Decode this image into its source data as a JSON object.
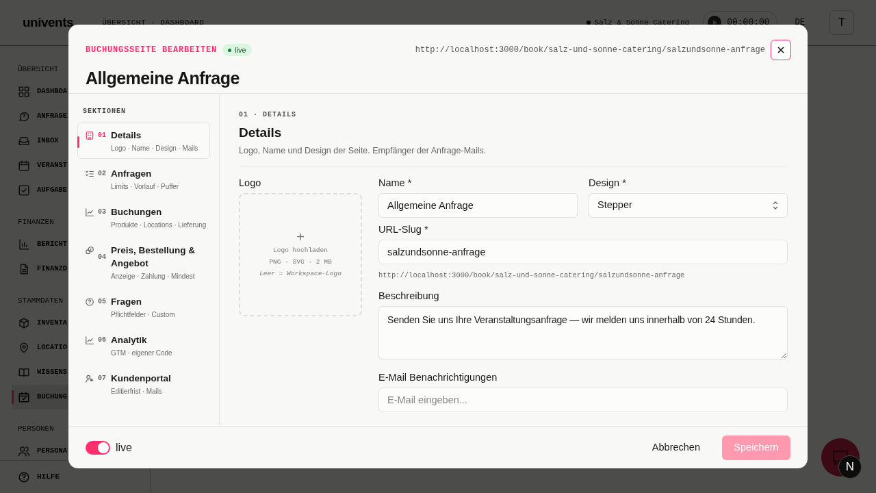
{
  "app": {
    "logo": "univents",
    "breadcrumb": "ÜBERSICHT · DASHBOARD",
    "workspace": "Salz & Sonne Catering",
    "timer": "00:00:00",
    "language": "DE",
    "avatar": "T"
  },
  "sidebar": {
    "groups": [
      {
        "title": "ÜBERSICHT",
        "items": [
          {
            "label": "DASHBOA",
            "selected": false
          },
          {
            "label": "ANFRAGE",
            "selected": false
          },
          {
            "label": "INBOX",
            "selected": false
          },
          {
            "label": "VERANST",
            "selected": false
          },
          {
            "label": "AUFGABE",
            "selected": false
          }
        ]
      },
      {
        "title": "FINANZEN",
        "items": [
          {
            "label": "BERICHT",
            "selected": false
          },
          {
            "label": "FINANZD",
            "selected": false
          }
        ]
      },
      {
        "title": "STAMMDATEN",
        "items": [
          {
            "label": "INVENTA",
            "selected": false
          },
          {
            "label": "LOCATIO",
            "selected": false
          },
          {
            "label": "WISSENS",
            "selected": false
          },
          {
            "label": "BUCHUNG",
            "selected": true
          }
        ]
      },
      {
        "title": "PERSONEN",
        "items": [
          {
            "label": "PERSONA",
            "selected": false
          }
        ]
      }
    ],
    "help": "HILFE"
  },
  "modal": {
    "eyebrow": "BUCHUNGSSEITE BEARBEITEN",
    "status": "live",
    "url": "http://localhost:3000/book/salz-und-sonne-catering/salzundsonne-anfrage",
    "title": "Allgemeine Anfrage",
    "sections_title": "SEKTIONEN",
    "sections": [
      {
        "number": "01",
        "title": "Details",
        "subtitle": "Logo · Name · Design · Mails",
        "selected": true
      },
      {
        "number": "02",
        "title": "Anfragen",
        "subtitle": "Limits · Vorlauf · Puffer",
        "selected": false
      },
      {
        "number": "03",
        "title": "Buchungen",
        "subtitle": "Produkte · Locations · Lieferung",
        "selected": false
      },
      {
        "number": "04",
        "title": "Preis, Bestellung & Angebot",
        "subtitle": "Anzeige · Zahlung · Mindest",
        "selected": false
      },
      {
        "number": "05",
        "title": "Fragen",
        "subtitle": "Pflichtfelder · Custom",
        "selected": false
      },
      {
        "number": "06",
        "title": "Analytik",
        "subtitle": "GTM · eigener Code",
        "selected": false
      },
      {
        "number": "07",
        "title": "Kundenportal",
        "subtitle": "Editierfrist · Mails",
        "selected": false
      }
    ],
    "content": {
      "eyebrow": "01 · DETAILS",
      "title": "Details",
      "description": "Logo, Name und Design der Seite. Empfänger der Anfrage-Mails.",
      "logo": {
        "label": "Logo",
        "plus": "+",
        "upload": "Logo hochladen",
        "formats": "PNG · SVG · 2 MB",
        "hint": "Leer = Workspace-Logo"
      },
      "name": {
        "label": "Name *",
        "value": "Allgemeine Anfrage"
      },
      "design": {
        "label": "Design *",
        "value": "Stepper"
      },
      "slug": {
        "label": "URL-Slug *",
        "value": "salzundsonne-anfrage",
        "preview": "http://localhost:3000/book/salz-und-sonne-catering/salzundsonne-anfrage"
      },
      "description_field": {
        "label": "Beschreibung",
        "value": "Senden Sie uns Ihre Veranstaltungsanfrage — wir melden uns innerhalb von 24 Stunden."
      },
      "email": {
        "label": "E-Mail Benachrichtigungen",
        "placeholder": "E-Mail eingeben..."
      }
    },
    "footer": {
      "live_on": true,
      "live_label": "live",
      "cancel": "Abbrechen",
      "save": "Speichern",
      "save_disabled": true
    }
  },
  "dev_badge": "N"
}
